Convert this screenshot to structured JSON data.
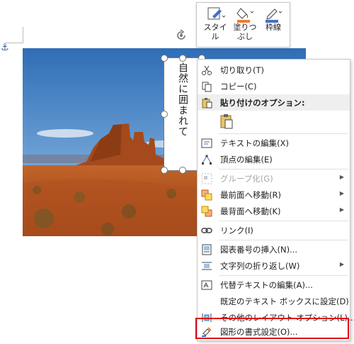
{
  "textbox": {
    "text": "自然に囲まれて"
  },
  "mini_toolbar": {
    "style_label": "スタイル",
    "fill_label_1": "塗りつ",
    "fill_label_2": "ぶし",
    "outline_label": "枠線"
  },
  "menu": {
    "cut": "切り取り(T)",
    "copy": "コピー(C)",
    "paste_options": "貼り付けのオプション:",
    "edit_text": "テキストの編集(X)",
    "edit_points": "頂点の編集(E)",
    "group": "グループ化(G)",
    "bring_front": "最前面へ移動(R)",
    "send_back": "最背面へ移動(K)",
    "link": "リンク(I)",
    "insert_caption": "図表番号の挿入(N)...",
    "wrap_text": "文字列の折り返し(W)",
    "edit_alt_text": "代替テキストの編集(A)...",
    "set_default_textbox": "既定のテキスト ボックスに設定(D)",
    "more_layout": "その他のレイアウト オプション(L)...",
    "format_shape": "図形の書式設定(O)..."
  },
  "colors": {
    "fill_accent": "#ed7d31",
    "outline_accent": "#4472c4",
    "highlight": "#e0001a"
  }
}
